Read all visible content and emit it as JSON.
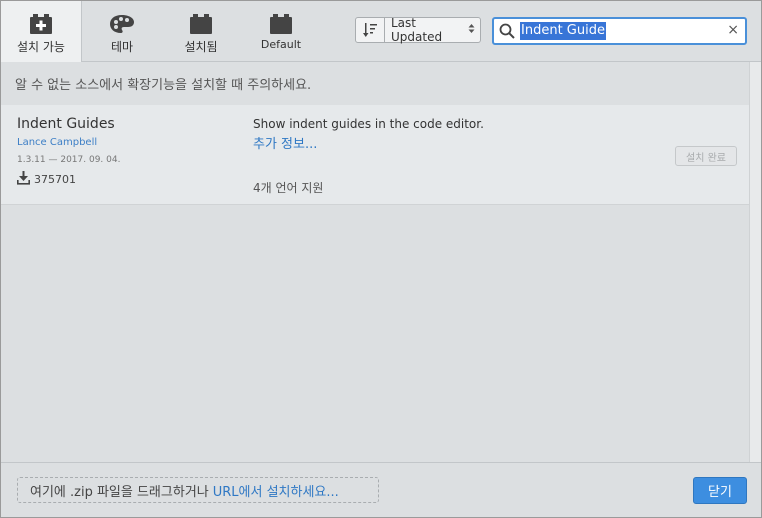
{
  "tabs": [
    {
      "label": "설치 가능",
      "icon": "plus-box-icon",
      "active": true
    },
    {
      "label": "테마",
      "icon": "palette-icon",
      "active": false
    },
    {
      "label": "설치됨",
      "icon": "box-icon",
      "active": false
    },
    {
      "label": "Default",
      "icon": "box-icon",
      "active": false
    }
  ],
  "sort": {
    "label": "Last Updated",
    "icon": "sort-icon"
  },
  "search": {
    "value": "Indent Guide",
    "icon": "search-icon",
    "clear_icon": "×"
  },
  "warning": "알 수 없는 소스에서 확장기능을 설치할 때 주의하세요.",
  "extension": {
    "name": "Indent Guides",
    "author": "Lance Campbell",
    "meta": "1.3.11 — 2017. 09. 04.",
    "downloads": "375701",
    "description": "Show indent guides in the code editor.",
    "more_info": "추가 정보...",
    "languages": "4개 언어 지원",
    "installed_label": "설치 완료"
  },
  "footer": {
    "drop_text": "여기에 .zip 파일을 드래그하거나",
    "drop_link": "URL에서 설치하세요...",
    "close_label": "닫기"
  },
  "colors": {
    "accent": "#3d8ee0",
    "link": "#2f78c4",
    "selection": "#3875d7"
  }
}
